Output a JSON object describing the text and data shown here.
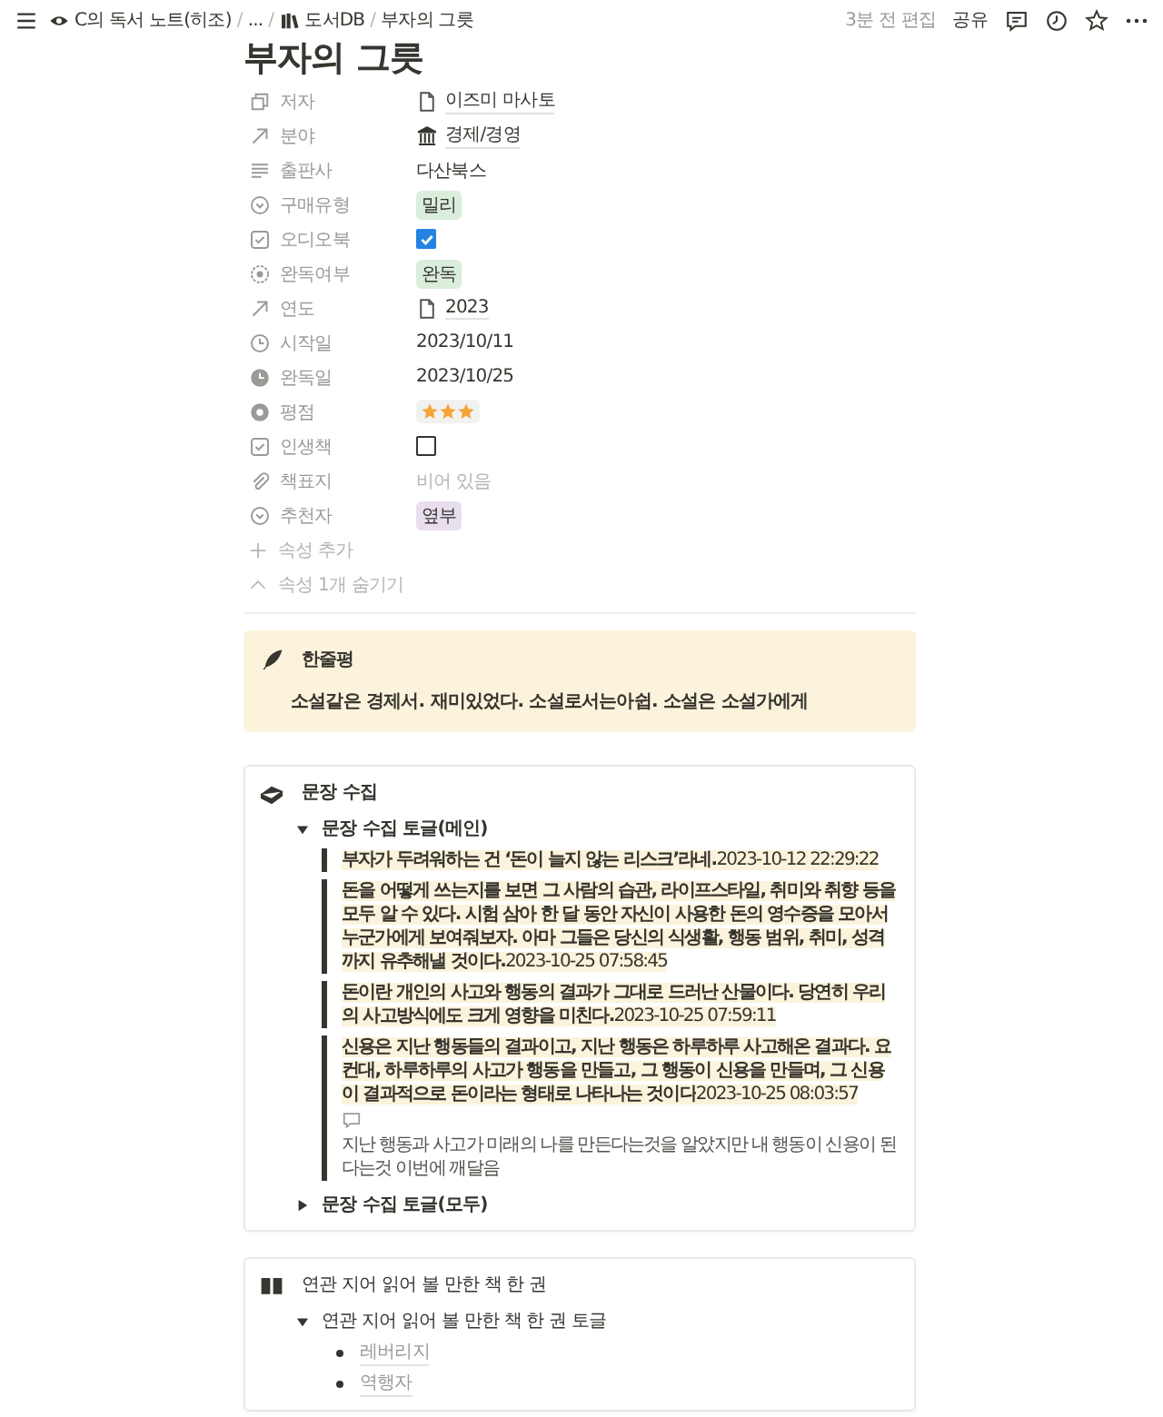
{
  "topbar": {
    "breadcrumbs": [
      {
        "label": "C의 독서 노트(히조)",
        "kind": "workspace",
        "separator": "/"
      },
      {
        "label": "...",
        "kind": "plain",
        "separator": "/"
      },
      {
        "label": "도서DB",
        "kind": "database",
        "separator": "/"
      },
      {
        "label": "부자의 그릇",
        "kind": "plain"
      }
    ],
    "edited": "3분 전 편집",
    "share": "공유"
  },
  "title": "부자의 그릇",
  "properties": [
    {
      "label": "저자",
      "kind": "relation",
      "value": "이즈미 마사토"
    },
    {
      "label": "분야",
      "kind": "category",
      "value": "경제/경영"
    },
    {
      "label": "출판사",
      "kind": "text",
      "value": "다산북스"
    },
    {
      "label": "구매유형",
      "kind": "select",
      "value": "밀리",
      "color": "#dbeddb"
    },
    {
      "label": "오디오북",
      "kind": "checkbox",
      "checked": true
    },
    {
      "label": "완독여부",
      "kind": "status",
      "value": "완독",
      "color": "#dbeddb"
    },
    {
      "label": "연도",
      "kind": "rollup",
      "value": "2023"
    },
    {
      "label": "시작일",
      "kind": "date",
      "value": "2023/10/11"
    },
    {
      "label": "완독일",
      "kind": "completed",
      "value": "2023/10/25"
    },
    {
      "label": "평점",
      "kind": "stars",
      "stars": 3
    },
    {
      "label": "인생책",
      "kind": "checkbox",
      "checked": false
    },
    {
      "label": "책표지",
      "kind": "files",
      "placeholder": "비어 있음"
    },
    {
      "label": "추천자",
      "kind": "select",
      "value": "옆부",
      "color": "#e8deee"
    }
  ],
  "add_property": "속성 추가",
  "hide_properties": "속성 1개 숨기기",
  "callout": {
    "title": "한줄평",
    "text": "소설같은 경제서. 재미있었다. 소설로서는아쉽. 소설은 소설가에게"
  },
  "quotes_section": {
    "title": "문장 수집",
    "toggles": [
      {
        "label": "문장 수집 토글(메인)",
        "expanded": true,
        "quotes": [
          {
            "text": "부자가 두려워하는 건 ‘돈이 늘지 않는 리스크’라네.",
            "timestamp": "2023-10-12 22:29:22"
          },
          {
            "text": "돈을 어떻게 쓰는지를 보면 그 사람의 습관, 라이프스타일, 취미와 취향 등을 모두 알 수 있다. 시험 삼아 한 달 동안 자신이 사용한 돈의 영수증을 모아서 누군가에게 보여줘보자. 아마 그들은 당신의 식생활, 행동 범위, 취미, 성격까지 유추해낼 것이다.",
            "timestamp": "2023-10-25 07:58:45"
          },
          {
            "text": "돈이란 개인의 사고와 행동의 결과가 그대로 드러난 산물이다. 당연히 우리의 사고방식에도 크게 영향을 미친다.",
            "timestamp": "2023-10-25 07:59:11"
          },
          {
            "text": "신용은 지난 행동들의 결과이고, 지난 행동은 하루하루 사고해온 결과다. 요컨대, 하루하루의 사고가 행동을 만들고, 그 행동이 신용을 만들며, 그 신용이 결과적으로 돈이라는 형태로 나타나는 것이다",
            "timestamp": "2023-10-25 08:03:57",
            "note": "지난 행동과 사고가 미래의 나를 만든다는것을 알았지만 내 행동이 신용이 된다는것 이번에 깨달음"
          }
        ]
      },
      {
        "label": "문장 수집 토글(모두)",
        "expanded": false
      }
    ]
  },
  "related_section": {
    "title": "연관 지어 읽어 볼 만한 책 한 권",
    "toggle": {
      "label": "연관 지어 읽어 볼 만한 책 한 권 토글",
      "expanded": true,
      "items": [
        "레버리지",
        "역행자"
      ]
    }
  }
}
